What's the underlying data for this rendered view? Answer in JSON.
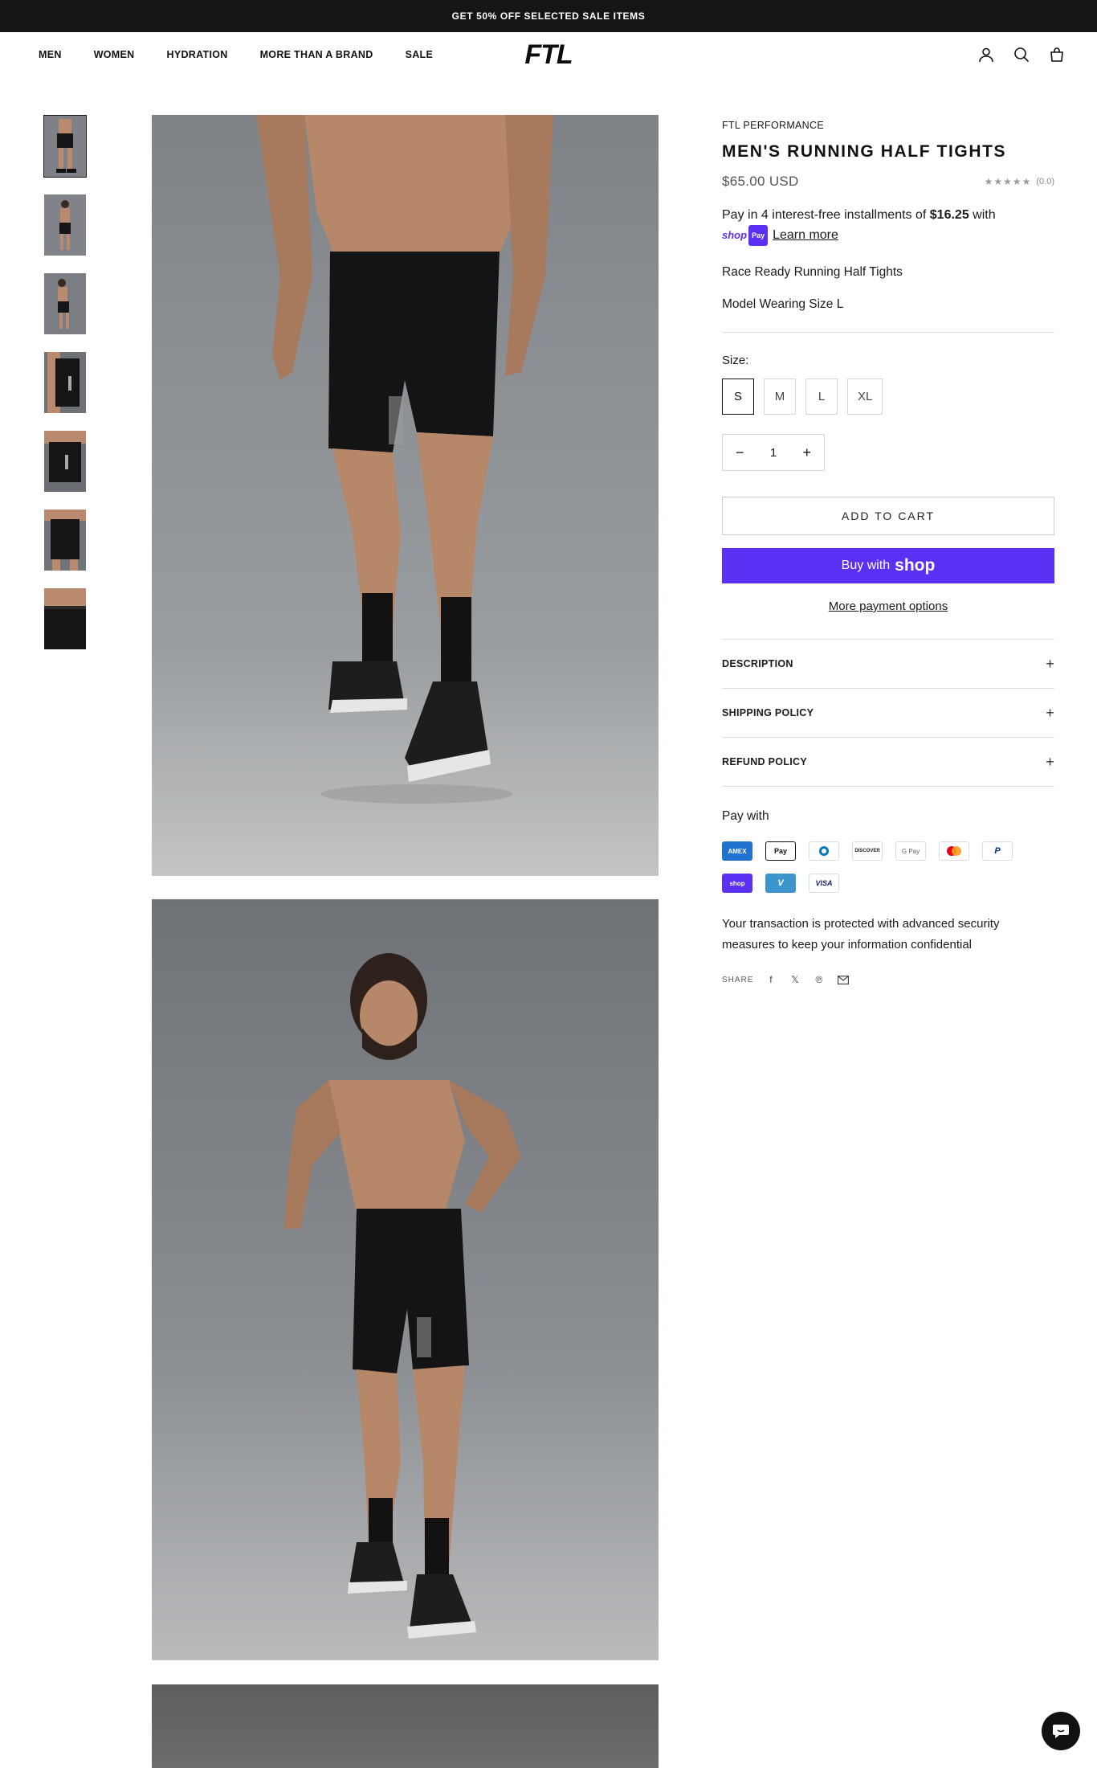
{
  "announcement": "GET 50% OFF SELECTED SALE ITEMS",
  "nav": {
    "items": [
      "MEN",
      "WOMEN",
      "HYDRATION",
      "MORE THAN A BRAND",
      "SALE"
    ],
    "logo": "FTL"
  },
  "product": {
    "vendor": "FTL PERFORMANCE",
    "title": "MEN'S RUNNING HALF TIGHTS",
    "price": "$65.00 USD",
    "rating_text": "(0.0)",
    "rating_value": 0,
    "installments_prefix": "Pay in 4 interest-free installments of ",
    "installment_amount": "$16.25",
    "installments_suffix": " with",
    "learn_more": "Learn more",
    "shoppay_word": "shop",
    "shoppay_pay": "Pay",
    "description_line1": "Race Ready Running Half Tights",
    "description_line2": "Model Wearing Size L",
    "size_label": "Size:",
    "sizes": [
      "S",
      "M",
      "L",
      "XL"
    ],
    "selected_size": "S",
    "quantity": "1",
    "add_to_cart": "ADD TO CART",
    "buy_with": "Buy with",
    "buy_shop_word": "shop",
    "more_payment": "More payment options"
  },
  "accordions": [
    "DESCRIPTION",
    "SHIPPING POLICY",
    "REFUND POLICY"
  ],
  "payment": {
    "label": "Pay with",
    "methods": [
      "American Express",
      "Apple Pay",
      "Diners Club",
      "Discover",
      "Google Pay",
      "Mastercard",
      "PayPal",
      "Shop Pay",
      "Venmo",
      "Visa"
    ]
  },
  "security_text": "Your transaction is protected with advanced security measures to keep your information confidential",
  "share_label": "SHARE",
  "colors": {
    "announcement_bg": "#151515",
    "shop_pay_purple": "#5a31f4",
    "photo_bg": "#8b8e92"
  }
}
